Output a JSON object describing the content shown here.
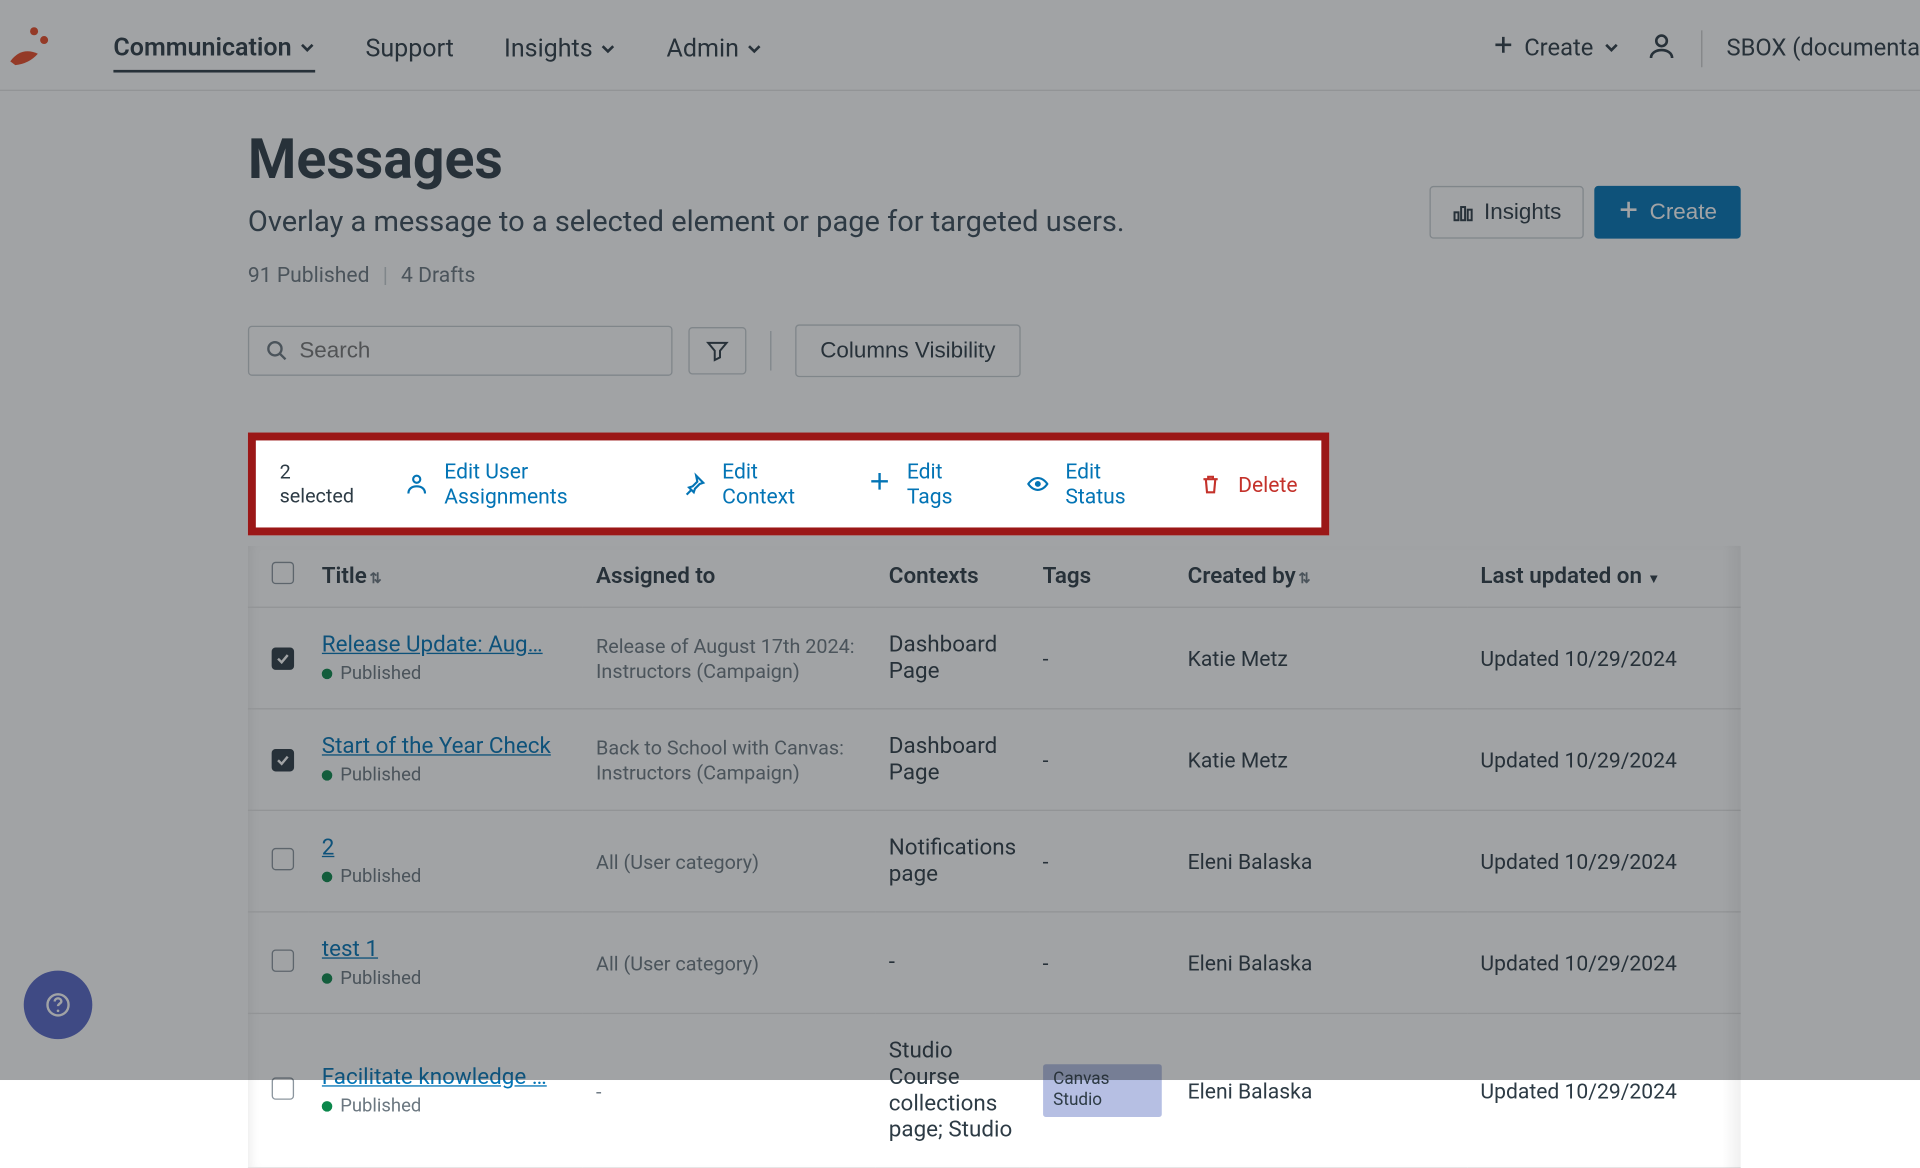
{
  "nav": {
    "items": [
      {
        "label": "Communication",
        "has_menu": true,
        "active": true
      },
      {
        "label": "Support",
        "has_menu": false,
        "active": false
      },
      {
        "label": "Insights",
        "has_menu": true,
        "active": false
      },
      {
        "label": "Admin",
        "has_menu": true,
        "active": false
      }
    ],
    "create_label": "Create",
    "org_label": "SBOX (documenta"
  },
  "page": {
    "title": "Messages",
    "subtitle": "Overlay a message to a selected element or page for targeted users.",
    "published_count": "91 Published",
    "drafts_count": "4 Drafts",
    "insights_btn": "Insights",
    "create_btn": "Create"
  },
  "toolbar": {
    "search_placeholder": "Search",
    "columns_btn": "Columns Visibility"
  },
  "bulk": {
    "selected_text": "2 selected",
    "edit_user": "Edit User Assignments",
    "edit_context": "Edit Context",
    "edit_tags": "Edit Tags",
    "edit_status": "Edit Status",
    "delete": "Delete"
  },
  "table": {
    "headers": {
      "title": "Title",
      "assigned": "Assigned to",
      "contexts": "Contexts",
      "tags": "Tags",
      "created": "Created by",
      "updated": "Last updated on"
    },
    "rows": [
      {
        "checked": true,
        "title": "Release Update: Aug…",
        "assigned": "Release of August 17th 2024: Instructors (Campaign)",
        "contexts": "Dashboard Page",
        "tags": "-",
        "created": "Katie Metz",
        "updated": "Updated 10/29/2024",
        "status": "Published"
      },
      {
        "checked": true,
        "title": "Start of the Year Check",
        "assigned": "Back to School with Canvas: Instructors (Campaign)",
        "contexts": "Dashboard Page",
        "tags": "-",
        "created": "Katie Metz",
        "updated": "Updated 10/29/2024",
        "status": "Published"
      },
      {
        "checked": false,
        "title": "2",
        "assigned": "All (User category)",
        "contexts": "Notifications page",
        "tags": "-",
        "created": "Eleni Balaska",
        "updated": "Updated 10/29/2024",
        "status": "Published"
      },
      {
        "checked": false,
        "title": "test 1",
        "assigned": "All (User category)",
        "contexts": "-",
        "tags": "-",
        "created": "Eleni Balaska",
        "updated": "Updated 10/29/2024",
        "status": "Published"
      },
      {
        "checked": false,
        "title": "Facilitate knowledge …",
        "assigned": "-",
        "contexts": "Studio Course collections page; Studio",
        "tags_pill": "Canvas Studio",
        "created": "Eleni Balaska",
        "updated": "Updated 10/29/2024",
        "status": "Published"
      }
    ]
  }
}
